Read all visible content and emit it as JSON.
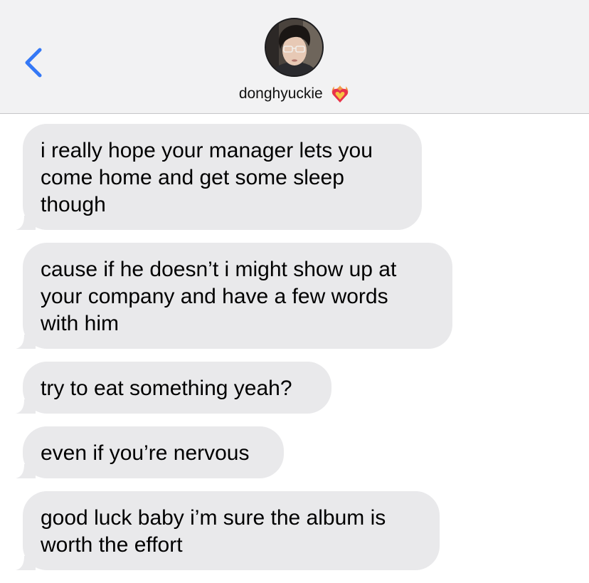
{
  "header": {
    "contact_name": "donghyuckie",
    "back_icon": "chevron-left-icon",
    "heart_icon": "heart-on-fire-icon",
    "accent_color": "#3478f6"
  },
  "messages": [
    {
      "lines": [
        "i really hope your manager lets you",
        "come home and get some sleep",
        "though"
      ]
    },
    {
      "lines": [
        "cause if he doesn’t i might show up at",
        "your company and have a few words",
        "with him"
      ]
    },
    {
      "lines": [
        "try to eat something yeah?"
      ]
    },
    {
      "lines": [
        "even if you’re nervous"
      ]
    },
    {
      "lines": [
        "good luck baby i’m sure the album is",
        "worth the effort"
      ]
    }
  ],
  "colors": {
    "header_bg": "#f2f2f3",
    "bubble_bg": "#e9e9eb",
    "text": "#000000"
  }
}
